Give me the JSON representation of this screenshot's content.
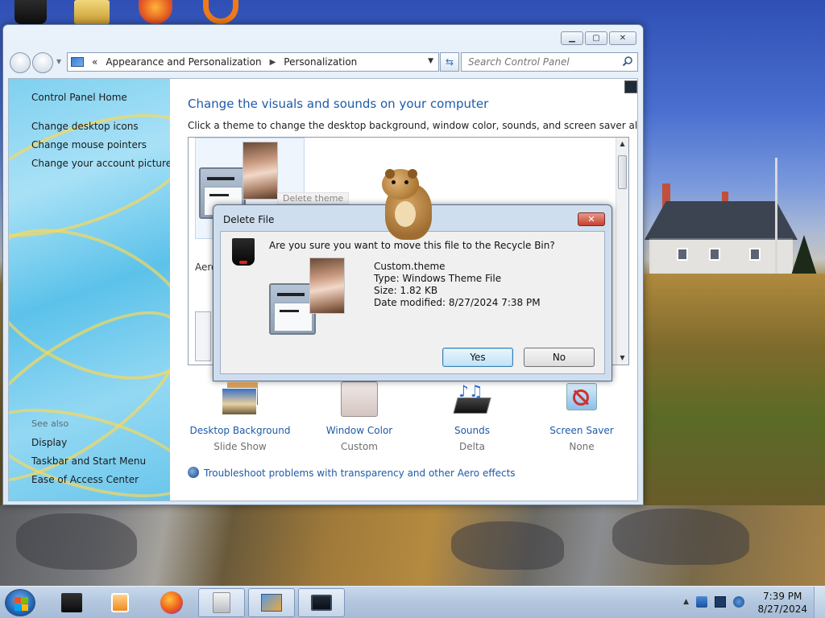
{
  "window": {
    "address": {
      "overflow": "«",
      "crumbs": [
        "Appearance and Personalization",
        "Personalization"
      ]
    },
    "search_placeholder": "Search Control Panel"
  },
  "sidebar": {
    "home": "Control Panel Home",
    "links": [
      "Change desktop icons",
      "Change mouse pointers",
      "Change your account picture"
    ],
    "see_also_heading": "See also",
    "see_also": [
      "Display",
      "Taskbar and Start Menu",
      "Ease of Access Center"
    ]
  },
  "main": {
    "title": "Change the visuals and sounds on your computer",
    "subtitle": "Click a theme to change the desktop background, window color, sounds, and screen saver all at once.",
    "delete_theme_label": "Delete theme",
    "aero_label": "Aero",
    "settings": [
      {
        "title": "Desktop Background",
        "value": "Slide Show",
        "icon": "desktop-background-icon"
      },
      {
        "title": "Window Color",
        "value": "Custom",
        "icon": "window-color-icon"
      },
      {
        "title": "Sounds",
        "value": "Delta",
        "icon": "sounds-icon"
      },
      {
        "title": "Screen Saver",
        "value": "None",
        "icon": "screen-saver-icon"
      }
    ],
    "troubleshoot": "Troubleshoot problems with transparency and other Aero effects"
  },
  "dialog": {
    "title": "Delete File",
    "close": "✕",
    "question": "Are you sure you want to move this file to the Recycle Bin?",
    "file_name": "Custom.theme",
    "file_type": "Type: Windows Theme File",
    "file_size": "Size: 1.82 KB",
    "file_modified": "Date modified: 8/27/2024 7:38 PM",
    "yes": "Yes",
    "no": "No"
  },
  "taskbar": {
    "items": [
      "recycle-bin-icon",
      "media-player-icon",
      "firefox-icon",
      "recycle-full-icon",
      "control-panel-icon",
      "monitor-icon"
    ],
    "time": "7:39 PM",
    "date": "8/27/2024"
  },
  "colors": {
    "link": "#1e5aa8",
    "title": "#1e5aa8",
    "taskbar": "#b2c6de"
  }
}
